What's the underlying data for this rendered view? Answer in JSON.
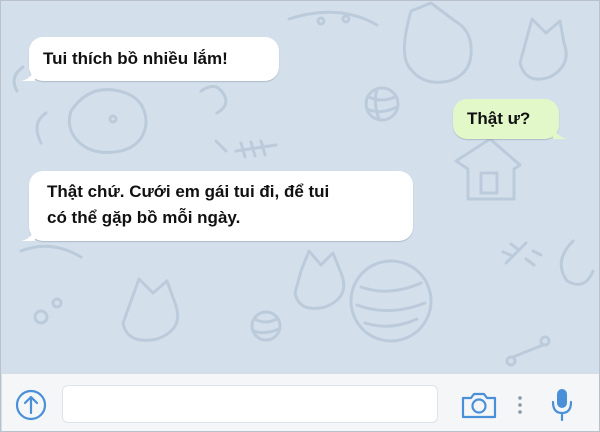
{
  "chat": {
    "messages": [
      {
        "direction": "incoming",
        "text": "Tui thích bồ nhiều lắm!"
      },
      {
        "direction": "outgoing",
        "text": "Thật ư?"
      },
      {
        "direction": "incoming",
        "lines": [
          "Thật chứ. Cưới em gái tui đi, để tui",
          "có thể gặp bồ mỗi ngày."
        ]
      }
    ],
    "wallpaper": "doodle-pets-pattern"
  },
  "composer": {
    "input_value": "",
    "input_placeholder": "",
    "icons": {
      "attach": "upload-arrow-circle-icon",
      "camera": "camera-icon",
      "more": "vertical-dots-icon",
      "mic": "microphone-icon"
    }
  },
  "colors": {
    "background": "#d3dfeb",
    "incoming_bubble": "#ffffff",
    "outgoing_bubble": "#e2f8c9",
    "icon_accent": "#4a90d9",
    "doodle": "#bccbdb"
  }
}
